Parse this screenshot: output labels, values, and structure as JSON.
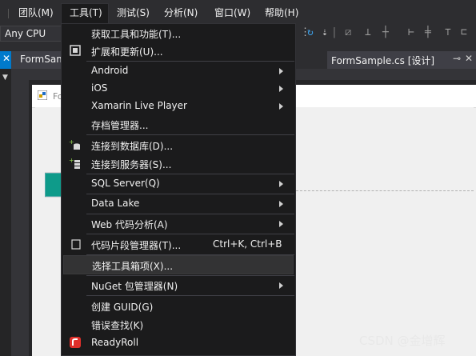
{
  "menubar": {
    "items": [
      {
        "label": "团队(M)"
      },
      {
        "label": "工具(T)"
      },
      {
        "label": "测试(S)"
      },
      {
        "label": "分析(N)"
      },
      {
        "label": "窗口(W)"
      },
      {
        "label": "帮助(H)"
      }
    ]
  },
  "toolbar": {
    "platform": "Any CPU"
  },
  "tabs": {
    "left": "FormSample",
    "right": "FormSample.cs [设计]",
    "right_pin": "⊸",
    "right_close": "✕"
  },
  "form": {
    "title": "Fo"
  },
  "tools_menu": {
    "items": [
      {
        "label": "获取工具和功能(T)..."
      },
      {
        "label": "扩展和更新(U)..."
      },
      {
        "label": "Android"
      },
      {
        "label": "iOS"
      },
      {
        "label": "Xamarin Live Player"
      },
      {
        "label": "存档管理器..."
      },
      {
        "label": "连接到数据库(D)..."
      },
      {
        "label": "连接到服务器(S)..."
      },
      {
        "label": "SQL Server(Q)"
      },
      {
        "label": "Data Lake"
      },
      {
        "label": "Web 代码分析(A)"
      },
      {
        "label": "代码片段管理器(T)...",
        "shortcut": "Ctrl+K, Ctrl+B"
      },
      {
        "label": "选择工具箱项(X)..."
      },
      {
        "label": "NuGet 包管理器(N)"
      },
      {
        "label": "创建 GUID(G)"
      },
      {
        "label": "错误查找(K)"
      },
      {
        "label": "ReadyRoll"
      }
    ]
  },
  "watermark": "CSDN @金增辉"
}
